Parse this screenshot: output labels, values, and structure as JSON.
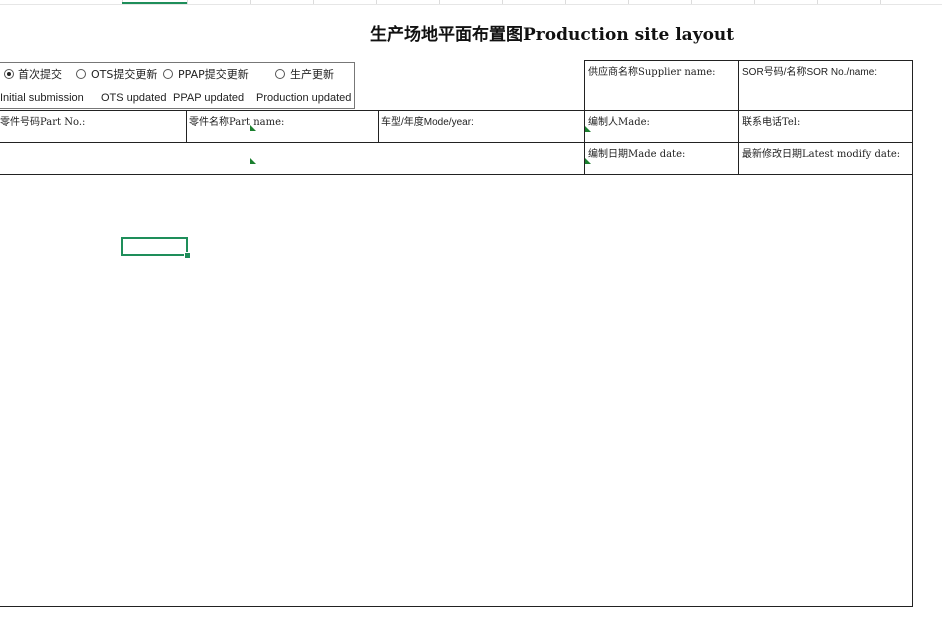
{
  "title": "生产场地平面布置图Production site layout",
  "submission_options": [
    {
      "cn": "首次提交",
      "en": "Initial submission",
      "checked": true
    },
    {
      "cn": "OTS提交更新",
      "en": "OTS updated",
      "checked": false
    },
    {
      "cn": "PPAP提交更新",
      "en": "PPAP updated",
      "checked": false
    },
    {
      "cn": "生产更新",
      "en": "Production updated",
      "checked": false
    }
  ],
  "fields": {
    "supplier_name": "供应商名称Supplier name:",
    "sor_no": "SOR号码/名称SOR No./name:",
    "part_no": "零件号码Part No.:",
    "part_name": "零件名称Part name:",
    "model_year": "车型/年度Mode/year:",
    "made_by": "编制人Made:",
    "tel": "联系电话Tel:",
    "made_date": "编制日期Made date:",
    "latest_modify_date": "最新修改日期Latest modify date:"
  }
}
